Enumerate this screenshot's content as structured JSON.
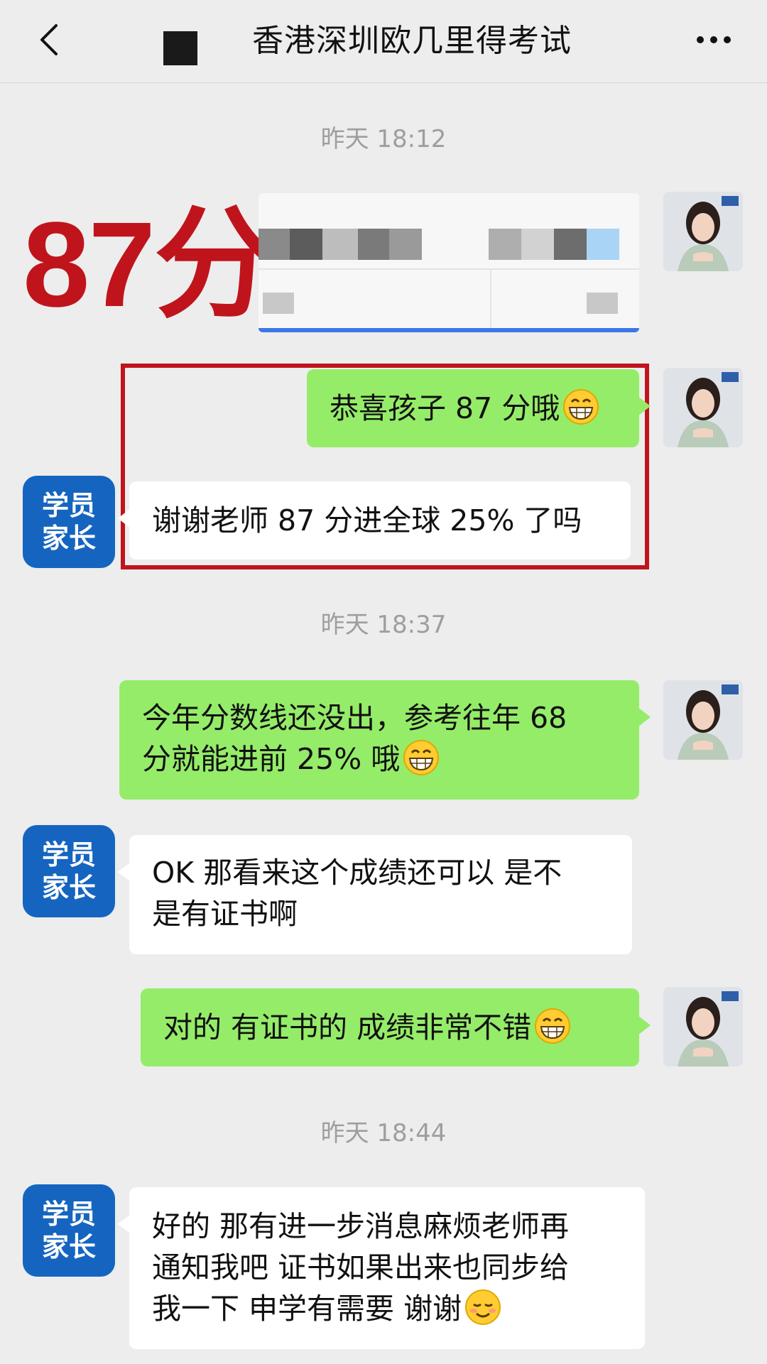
{
  "header": {
    "back_icon": "chevron-left-icon",
    "title": "香港深圳欧几里得考试",
    "more_icon": "more-dots-icon"
  },
  "colors": {
    "sent_bubble": "#95ec69",
    "received_bubble": "#ffffff",
    "background": "#ededed",
    "highlight_red": "#c0141c",
    "parent_avatar": "#1565c0"
  },
  "messages": [
    {
      "type": "timestamp",
      "text": "昨天 18:12"
    },
    {
      "type": "image",
      "sender": "teacher",
      "overlay_label": "87分",
      "content": "blurred-score-screenshot"
    },
    {
      "type": "text",
      "sender": "teacher",
      "text": "恭喜孩子 87 分哦",
      "emoji": "grin-emoji"
    },
    {
      "type": "text",
      "sender": "parent",
      "text": "谢谢老师 87 分进全球 25% 了吗"
    },
    {
      "type": "timestamp",
      "text": "昨天 18:37"
    },
    {
      "type": "text",
      "sender": "teacher",
      "lines": [
        "今年分数线还没出，参考往年 68",
        "分就能进前 25% 哦"
      ],
      "emoji": "grin-emoji"
    },
    {
      "type": "text",
      "sender": "parent",
      "lines": [
        "OK 那看来这个成绩还可以 是不",
        "是有证书啊"
      ]
    },
    {
      "type": "text",
      "sender": "teacher",
      "text": "对的 有证书的 成绩非常不错",
      "emoji": "grin-emoji"
    },
    {
      "type": "timestamp",
      "text": "昨天 18:44"
    },
    {
      "type": "text",
      "sender": "parent",
      "lines": [
        "好的 那有进一步消息麻烦老师再",
        "通知我吧 证书如果出来也同步给",
        "我一下 申学有需要 谢谢"
      ],
      "emoji": "smile-emoji"
    }
  ],
  "avatars": {
    "parent_label_line1": "学员",
    "parent_label_line2": "家长",
    "teacher_icon": "teacher-avatar-photo"
  }
}
